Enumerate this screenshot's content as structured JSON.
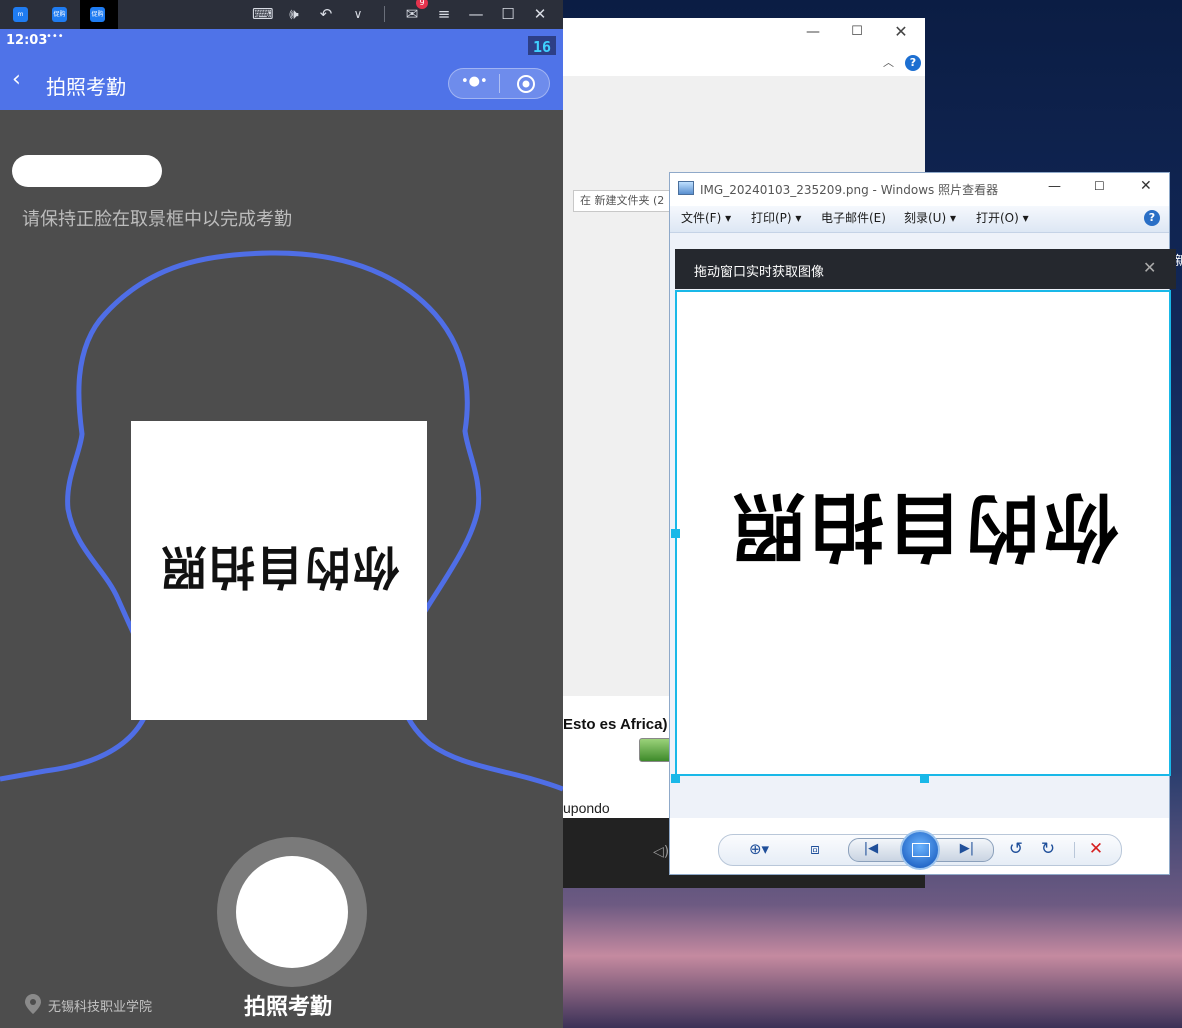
{
  "emulator": {
    "tabs": [
      {
        "icon": "app-logo-icon",
        "label": ""
      },
      {
        "icon": "tab-app-icon",
        "label": "促购"
      },
      {
        "icon": "tab-app-icon",
        "label": "促购"
      }
    ],
    "controls": [
      "keyboard-icon",
      "volume-icon",
      "undo-icon",
      "chevron-down-icon",
      "mail-icon",
      "menu-icon",
      "minimize-icon",
      "maximize-icon",
      "close-icon"
    ],
    "mail_badge": "9"
  },
  "phone": {
    "time": "12:03",
    "status_dots": "•••",
    "status_badge": "16",
    "nav_title": "拍照考勤",
    "hint": "请保持正脸在取景框中以完成考勤",
    "preview_text": "你的自拍照",
    "location": "无锡科技职业学院",
    "shutter_label": "拍照考勤",
    "outline_color": "#4f6ee6"
  },
  "behind_window": {
    "path_fragment": "在 新建文件夹 (2",
    "media_title": "Esto es Africa)",
    "artist": "upondo"
  },
  "viewer": {
    "title": "IMG_20240103_235209.png - Windows 照片查看器",
    "menus": [
      "文件(F)",
      "打印(P)",
      "电子邮件(E)",
      "刻录(U)",
      "打开(O)"
    ],
    "capture_bar_title": "拖动窗口实时获取图像",
    "image_text": "你的自拍照"
  },
  "desktop": {
    "edge_text": "新"
  }
}
